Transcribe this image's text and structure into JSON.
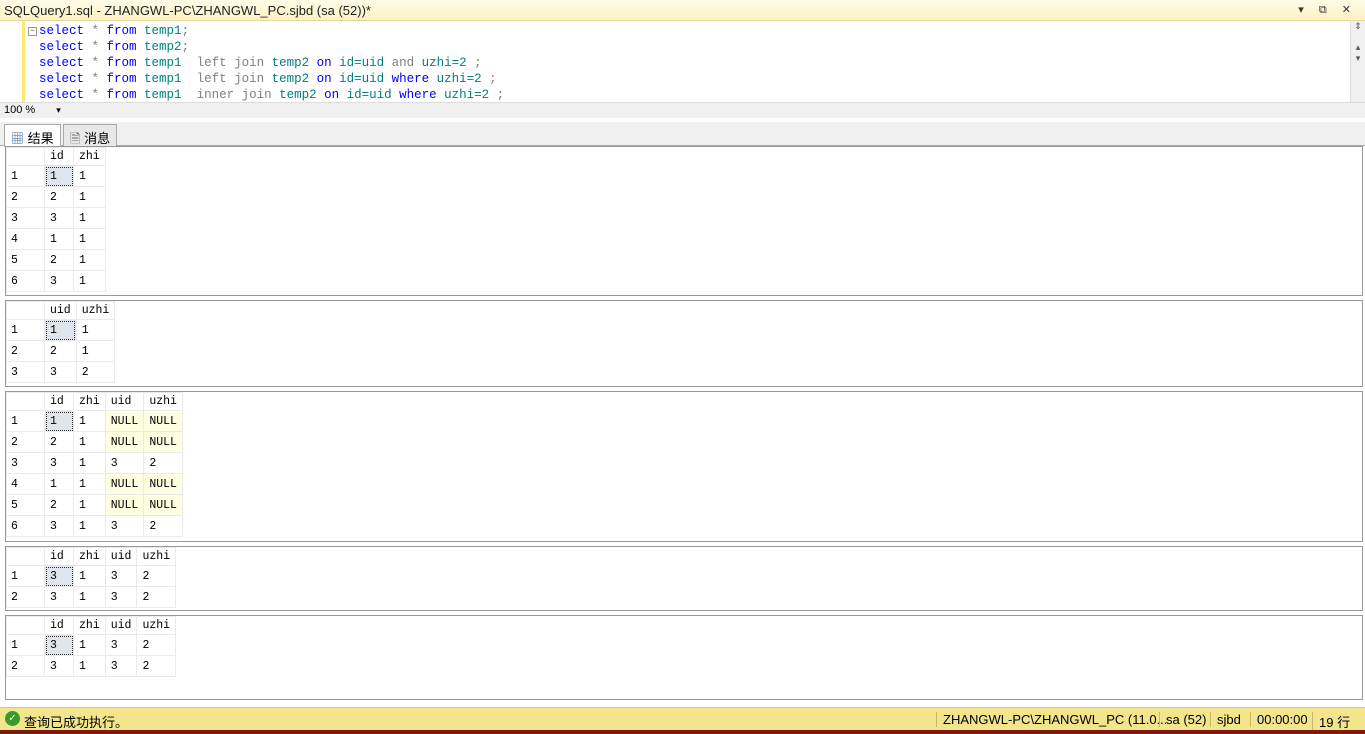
{
  "window": {
    "title": "SQLQuery1.sql - ZHANGWL-PC\\ZHANGWL_PC.sjbd (sa (52))*",
    "controls": "▾ ⧉ ✕"
  },
  "editor": {
    "lines": [
      [
        [
          "kw",
          "select"
        ],
        [
          "gr",
          " * "
        ],
        [
          "kw",
          "from"
        ],
        [
          "id",
          " temp1"
        ],
        [
          "gr",
          ";"
        ]
      ],
      [
        [
          "kw",
          "select"
        ],
        [
          "gr",
          " * "
        ],
        [
          "kw",
          "from"
        ],
        [
          "id",
          " temp2"
        ],
        [
          "gr",
          ";"
        ]
      ],
      [
        [
          "kw",
          "select"
        ],
        [
          "gr",
          " * "
        ],
        [
          "kw",
          "from"
        ],
        [
          "id",
          " temp1"
        ],
        [
          "gr",
          "  left join "
        ],
        [
          "id",
          "temp2"
        ],
        [
          "kw",
          " on "
        ],
        [
          "id",
          "id=uid"
        ],
        [
          "gr",
          " and "
        ],
        [
          "id",
          "uzhi=2"
        ],
        [
          "gr",
          " ;"
        ]
      ],
      [
        [
          "kw",
          "select"
        ],
        [
          "gr",
          " * "
        ],
        [
          "kw",
          "from"
        ],
        [
          "id",
          " temp1"
        ],
        [
          "gr",
          "  left join "
        ],
        [
          "id",
          "temp2"
        ],
        [
          "kw",
          " on "
        ],
        [
          "id",
          "id=uid"
        ],
        [
          "kw",
          " where "
        ],
        [
          "id",
          "uzhi=2"
        ],
        [
          "gr",
          " ;"
        ]
      ],
      [
        [
          "kw",
          "select"
        ],
        [
          "gr",
          " * "
        ],
        [
          "kw",
          "from"
        ],
        [
          "id",
          " temp1"
        ],
        [
          "gr",
          "  inner join "
        ],
        [
          "id",
          "temp2"
        ],
        [
          "kw",
          " on "
        ],
        [
          "id",
          "id=uid"
        ],
        [
          "kw",
          " where "
        ],
        [
          "id",
          "uzhi=2"
        ],
        [
          "gr",
          " ;"
        ]
      ]
    ]
  },
  "zoom": {
    "value": "100 %"
  },
  "tabs": [
    {
      "label": "结果",
      "icon": "grid-icon"
    },
    {
      "label": "消息",
      "icon": "document-icon"
    }
  ],
  "results": [
    {
      "columns": [
        "id",
        "zhi"
      ],
      "rows": [
        [
          "1",
          "1"
        ],
        [
          "2",
          "1"
        ],
        [
          "3",
          "1"
        ],
        [
          "1",
          "1"
        ],
        [
          "2",
          "1"
        ],
        [
          "3",
          "1"
        ]
      ]
    },
    {
      "columns": [
        "uid",
        "uzhi"
      ],
      "rows": [
        [
          "1",
          "1"
        ],
        [
          "2",
          "1"
        ],
        [
          "3",
          "2"
        ]
      ]
    },
    {
      "columns": [
        "id",
        "zhi",
        "uid",
        "uzhi"
      ],
      "rows": [
        [
          "1",
          "1",
          "NULL",
          "NULL"
        ],
        [
          "2",
          "1",
          "NULL",
          "NULL"
        ],
        [
          "3",
          "1",
          "3",
          "2"
        ],
        [
          "1",
          "1",
          "NULL",
          "NULL"
        ],
        [
          "2",
          "1",
          "NULL",
          "NULL"
        ],
        [
          "3",
          "1",
          "3",
          "2"
        ]
      ]
    },
    {
      "columns": [
        "id",
        "zhi",
        "uid",
        "uzhi"
      ],
      "rows": [
        [
          "3",
          "1",
          "3",
          "2"
        ],
        [
          "3",
          "1",
          "3",
          "2"
        ]
      ]
    },
    {
      "columns": [
        "id",
        "zhi",
        "uid",
        "uzhi"
      ],
      "rows": [
        [
          "3",
          "1",
          "3",
          "2"
        ],
        [
          "3",
          "1",
          "3",
          "2"
        ]
      ]
    }
  ],
  "status": {
    "message": "查询已成功执行。",
    "server": "ZHANGWL-PC\\ZHANGWL_PC (11.0...",
    "user": "sa (52)",
    "database": "sjbd",
    "elapsed": "00:00:00",
    "rows": "19 行"
  },
  "colors": {
    "status_bg": "#f2e58c",
    "keyword": "#0000ff",
    "identifier": "#008080",
    "null_cell": "#ffffe1"
  }
}
